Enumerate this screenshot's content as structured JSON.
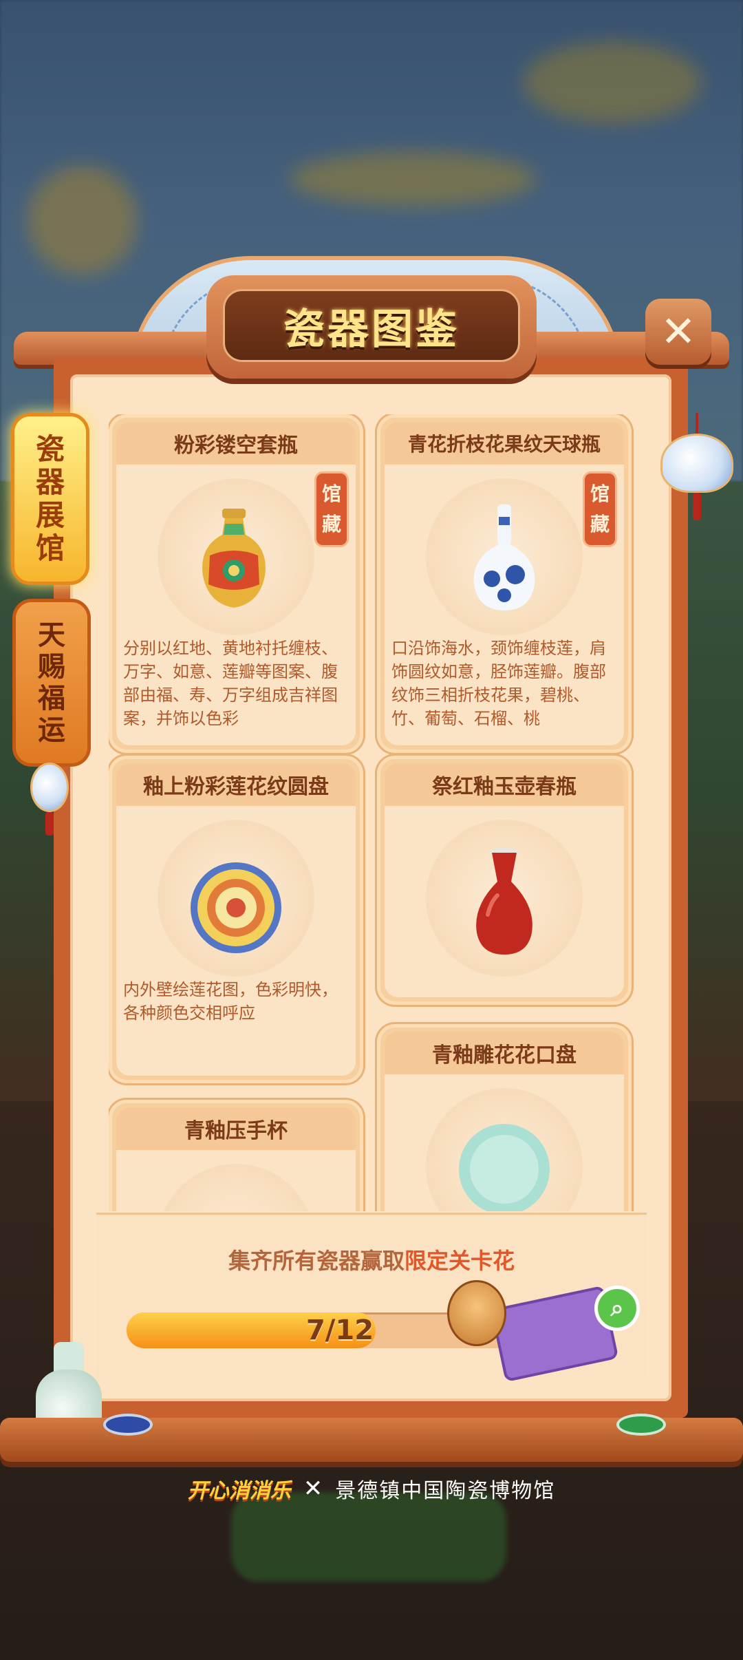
{
  "title": "瓷器图鉴",
  "close_symbol": "✕",
  "tabs": [
    {
      "label": [
        "瓷",
        "器",
        "展",
        "馆"
      ],
      "active": true
    },
    {
      "label": [
        "天",
        "赐",
        "福",
        "运"
      ],
      "active": false
    }
  ],
  "collection_stamp": [
    "馆",
    "藏"
  ],
  "items": [
    {
      "name": "粉彩镂空套瓶",
      "stamp": true,
      "description": "分别以红地、黄地衬托缠枝、万字、如意、莲瓣等图案、腹部由福、寿、万字组成吉祥图案，并饰以色彩"
    },
    {
      "name": "青花折枝花果纹天球瓶",
      "stamp": true,
      "description": "口沿饰海水，颈饰缠枝莲，肩饰圆纹如意，胫饰莲瓣。腹部纹饰三相折枝花果，碧桃、竹、葡萄、石榴、桃"
    },
    {
      "name": "釉上粉彩莲花纹圆盘",
      "stamp": false,
      "description": "内外壁绘莲花图，色彩明快，各种颜色交相呼应"
    },
    {
      "name": "祭红釉玉壶春瓶",
      "stamp": false,
      "description": ""
    },
    {
      "name": "青釉雕花花口盘",
      "stamp": false,
      "description": ""
    },
    {
      "name": "青釉压手杯",
      "stamp": false,
      "description": ""
    }
  ],
  "reward": {
    "prefix": "集齐所有瓷器赢取",
    "highlight": "限定关卡花",
    "progress_text": "7/12",
    "collected": 7,
    "total": 12
  },
  "footer": {
    "brand_left": "开心消消乐",
    "separator": "✕",
    "brand_right": "景德镇中国陶瓷博物馆"
  },
  "colors": {
    "accent": "#c8602f",
    "title_text": "#ffe58a",
    "highlight": "#e2572a",
    "card_title": "#7b3a18",
    "description": "#b05a2c"
  },
  "icons": {
    "close": "close-icon",
    "search": "magnifier-icon",
    "charm": "porcelain-charm-icon"
  }
}
